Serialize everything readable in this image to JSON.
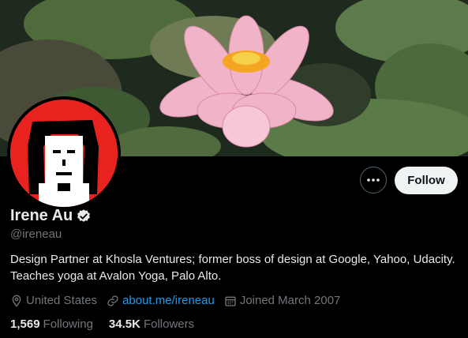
{
  "profile": {
    "name": "Irene Au",
    "handle": "@ireneau",
    "bio_line1": "Design Partner at Khosla Ventures; former boss of design at Google, Yahoo, Udacity.",
    "bio_line2": "Teaches yoga at Avalon Yoga, Palo Alto.",
    "location": "United States",
    "website": "about.me/ireneau",
    "joined": "Joined March 2007",
    "following_count": "1,569",
    "following_label": "Following",
    "followers_count": "34.5K",
    "followers_label": "Followers"
  },
  "actions": {
    "follow_label": "Follow"
  },
  "icons": {
    "more": "more-icon",
    "verified": "verified-badge-icon",
    "location": "location-pin-icon",
    "link": "link-icon",
    "calendar": "calendar-icon"
  },
  "colors": {
    "background": "#000000",
    "link": "#1d9bf0",
    "secondary_text": "#71767b",
    "avatar_bg": "#e8231f",
    "follow_button": "#eff3f4"
  }
}
